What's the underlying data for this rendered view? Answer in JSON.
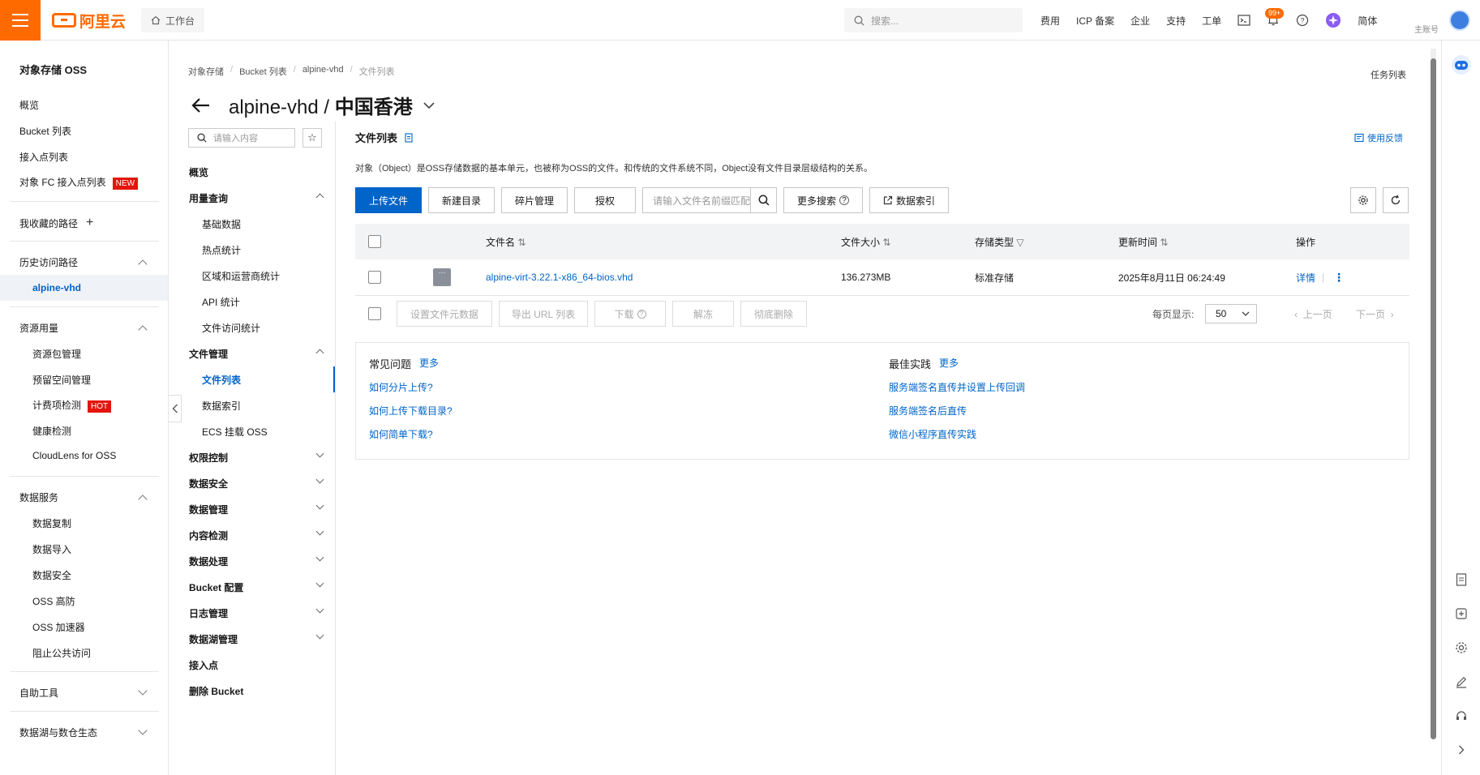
{
  "topbar": {
    "brand": "阿里云",
    "workbench": "工作台",
    "search_placeholder": "搜索...",
    "links": [
      "费用",
      "ICP 备案",
      "企业",
      "支持",
      "工单"
    ],
    "notification_badge": "99+",
    "language": "简体",
    "account": "主账号"
  },
  "sidebar": {
    "title": "对象存储 OSS",
    "items": [
      "概览",
      "Bucket 列表",
      "接入点列表"
    ],
    "fc_item": "对象 FC 接入点列表",
    "fc_tag": "NEW",
    "favorites": "我收藏的路径",
    "history_head": "历史访问路径",
    "history_active": "alpine-vhd",
    "resource_head": "资源用量",
    "resource_items": [
      "资源包管理",
      "预留空间管理"
    ],
    "billing_item": "计费项检测",
    "billing_tag": "HOT",
    "resource_items2": [
      "健康检测",
      "CloudLens for OSS"
    ],
    "data_head": "数据服务",
    "data_items": [
      "数据复制",
      "数据导入",
      "数据安全",
      "OSS 高防",
      "OSS 加速器",
      "阻止公共访问"
    ],
    "tools_head": "自助工具",
    "lake_head": "数据湖与数仓生态"
  },
  "breadcrumb": [
    "对象存储",
    "Bucket 列表",
    "alpine-vhd",
    "文件列表"
  ],
  "page_title": {
    "bucket": "alpine-vhd",
    "sep": " / ",
    "region": "中国香港"
  },
  "task_list": "任务列表",
  "subnav": {
    "search_placeholder": "请输入内容",
    "overview": "概览",
    "usage_head": "用量查询",
    "usage_items": [
      "基础数据",
      "热点统计",
      "区域和运营商统计",
      "API 统计",
      "文件访问统计"
    ],
    "files_head": "文件管理",
    "files_active": "文件列表",
    "files_items": [
      "数据索引",
      "ECS 挂载 OSS"
    ],
    "groups": [
      "权限控制",
      "数据安全",
      "数据管理",
      "内容检测",
      "数据处理",
      "Bucket 配置",
      "日志管理",
      "数据湖管理"
    ],
    "tail_items": [
      "接入点",
      "删除 Bucket"
    ]
  },
  "main": {
    "section_title": "文件列表",
    "feedback": "使用反馈",
    "description": "对象（Object）是OSS存储数据的基本单元，也被称为OSS的文件。和传统的文件系统不同，Object没有文件目录层级结构的关系。",
    "toolbar": {
      "upload": "上传文件",
      "new_dir": "新建目录",
      "fragments": "碎片管理",
      "authorize": "授权",
      "search_placeholder": "请输入文件名前缀匹配",
      "more_search": "更多搜索",
      "data_index": "数据索引"
    },
    "table": {
      "headers": {
        "name": "文件名",
        "size": "文件大小",
        "storage": "存储类型",
        "updated": "更新时间",
        "actions": "操作"
      },
      "rows": [
        {
          "name": "alpine-virt-3.22.1-x86_64-bios.vhd",
          "size": "136.273MB",
          "storage": "标准存储",
          "updated": "2025年8月11日 06:24:49",
          "detail": "详情"
        }
      ]
    },
    "bulk": {
      "set_meta": "设置文件元数据",
      "export_url": "导出 URL 列表",
      "download": "下载",
      "unfreeze": "解冻",
      "delete": "彻底删除",
      "per_page_label": "每页显示:",
      "per_page_value": "50",
      "prev": "上一页",
      "next": "下一页"
    },
    "faq": {
      "left_title": "常见问题",
      "left_more": "更多",
      "left_links": [
        "如何分片上传?",
        "如何上传下载目录?",
        "如何简单下载?"
      ],
      "right_title": "最佳实践",
      "right_more": "更多",
      "right_links": [
        "服务端签名直传并设置上传回调",
        "服务端签名后直传",
        "微信小程序直传实践"
      ]
    }
  }
}
